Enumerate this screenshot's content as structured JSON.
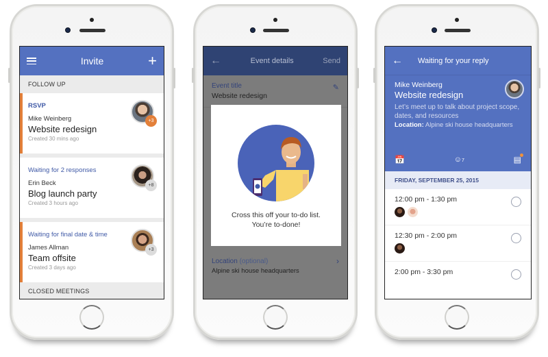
{
  "theme": {
    "primary": "#5471c0",
    "primary_dark": "#2f4373",
    "accent_orange": "#e3803a",
    "link_blue": "#3f59a6"
  },
  "phone1": {
    "appbar": {
      "menu_icon": "hamburger-icon",
      "title": "Invite",
      "add_icon": "plus-icon"
    },
    "sections": {
      "follow_up": "FOLLOW UP",
      "closed": "CLOSED MEETINGS"
    },
    "cards": [
      {
        "status": "RSVP",
        "person": "Mike Weinberg",
        "meeting": "Website redesign",
        "created": "Created 30 mins ago",
        "badge": "+3",
        "accent": true
      },
      {
        "status": "Waiting for 2 responses",
        "person": "Erin Beck",
        "meeting": "Blog launch party",
        "created": "Created 3 hours ago",
        "badge": "+8",
        "accent": false
      },
      {
        "status": "Waiting for final date & time",
        "person": "James Allman",
        "meeting": "Team offsite",
        "created": "Created 3 days ago",
        "badge": "+3",
        "accent": true
      }
    ]
  },
  "phone2": {
    "appbar": {
      "back_icon": "arrow-left-icon",
      "title": "Event details",
      "send": "Send"
    },
    "event_title_label": "Event title",
    "event_title_value": "Website redesign",
    "location_label": "Location",
    "location_optional": "(optional)",
    "location_value": "Alpine ski house headquarters",
    "modal": {
      "line1": "Cross this off your to-do list.",
      "line2": "You’re to-done!"
    }
  },
  "phone3": {
    "appbar": {
      "back_icon": "arrow-left-icon",
      "title": "Waiting for your reply"
    },
    "organizer": "Mike Weinberg",
    "meeting": "Website redesign",
    "description": "Let’s meet up to talk about project scope, dates, and resources",
    "location_label": "Location:",
    "location_value": "Alpine ski house headquarters",
    "attendee_count": "7",
    "date_header": "FRIDAY, SEPTEMBER 25, 2015",
    "slots": [
      {
        "time": "12:00 pm - 1:30 pm",
        "votes": 2
      },
      {
        "time": "12:30 pm - 2:00 pm",
        "votes": 1
      },
      {
        "time": "2:00 pm - 3:30 pm",
        "votes": 0
      }
    ]
  }
}
